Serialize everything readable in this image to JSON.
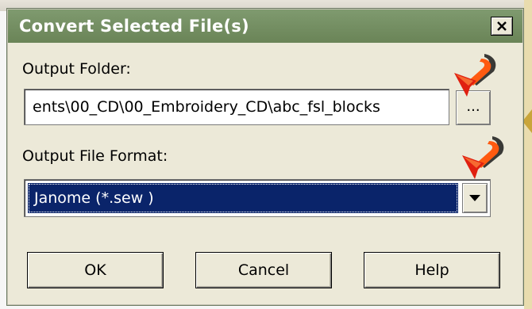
{
  "dialog": {
    "title": "Convert Selected File(s)",
    "close_icon": "close-icon"
  },
  "output_folder": {
    "label": "Output Folder:",
    "value": "ents\\00_CD\\00_Embroidery_CD\\abc_fsl_blocks",
    "browse_label": "..."
  },
  "output_format": {
    "label": "Output File Format:",
    "selected": "Janome (*.sew )",
    "dropdown_icon": "chevron-down-icon"
  },
  "buttons": {
    "ok": "OK",
    "cancel": "Cancel",
    "help": "Help"
  },
  "annotations": {
    "pointer_icon": "red-arrow-pointer-icon",
    "pointer_color": "#e02010"
  },
  "colors": {
    "titlebar": "#7f9a6f",
    "selection": "#0a246a",
    "dialog_bg": "#ece9d8"
  }
}
